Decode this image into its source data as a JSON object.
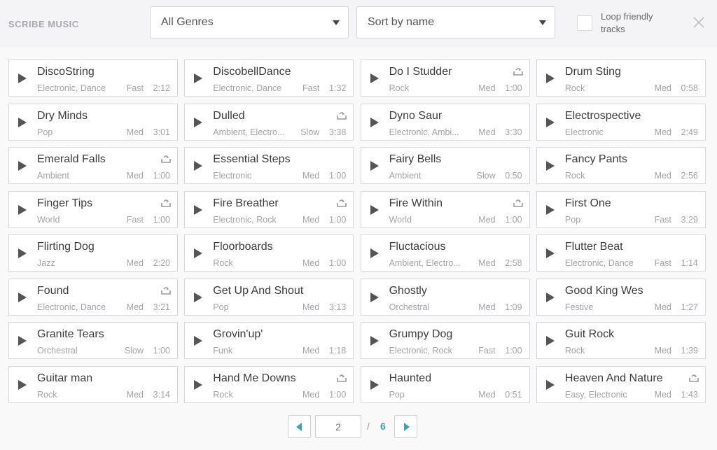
{
  "header": {
    "brand": "SCRIBE MUSIC",
    "genre_select": "All Genres",
    "sort_select": "Sort by name",
    "loop_label": "Loop friendly tracks"
  },
  "tracks": [
    {
      "title": "DiscoString",
      "genre": "Electronic, Dance",
      "speed": "Fast",
      "duration": "2:12",
      "loop": false
    },
    {
      "title": "DiscobellDance",
      "genre": "Electronic, Dance",
      "speed": "Fast",
      "duration": "1:32",
      "loop": false
    },
    {
      "title": "Do I Studder",
      "genre": "Rock",
      "speed": "Med",
      "duration": "1:00",
      "loop": true
    },
    {
      "title": "Drum Sting",
      "genre": "Rock",
      "speed": "Med",
      "duration": "0:58",
      "loop": false
    },
    {
      "title": "Dry Minds",
      "genre": "Pop",
      "speed": "Med",
      "duration": "3:01",
      "loop": false
    },
    {
      "title": "Dulled",
      "genre": "Ambient, Electro...",
      "speed": "Slow",
      "duration": "3:38",
      "loop": true
    },
    {
      "title": "Dyno Saur",
      "genre": "Electronic, Ambi...",
      "speed": "Med",
      "duration": "3:30",
      "loop": false
    },
    {
      "title": "Electrospective",
      "genre": "Electronic",
      "speed": "Med",
      "duration": "2:49",
      "loop": false
    },
    {
      "title": "Emerald Falls",
      "genre": "Ambient",
      "speed": "Med",
      "duration": "1:00",
      "loop": true
    },
    {
      "title": "Essential Steps",
      "genre": "Electronic",
      "speed": "Med",
      "duration": "1:00",
      "loop": false
    },
    {
      "title": "Fairy Bells",
      "genre": "Ambient",
      "speed": "Slow",
      "duration": "0:50",
      "loop": false
    },
    {
      "title": "Fancy Pants",
      "genre": "Rock",
      "speed": "Med",
      "duration": "2:56",
      "loop": false
    },
    {
      "title": "Finger Tips",
      "genre": "World",
      "speed": "Fast",
      "duration": "1:00",
      "loop": true
    },
    {
      "title": "Fire Breather",
      "genre": "Electronic, Rock",
      "speed": "Med",
      "duration": "1:00",
      "loop": true
    },
    {
      "title": "Fire Within",
      "genre": "World",
      "speed": "Med",
      "duration": "1:00",
      "loop": true
    },
    {
      "title": "First One",
      "genre": "Pop",
      "speed": "Fast",
      "duration": "3:29",
      "loop": false
    },
    {
      "title": "Flirting Dog",
      "genre": "Jazz",
      "speed": "Med",
      "duration": "2:20",
      "loop": false
    },
    {
      "title": "Floorboards",
      "genre": "Rock",
      "speed": "Med",
      "duration": "1:00",
      "loop": false
    },
    {
      "title": "Fluctacious",
      "genre": "Ambient, Electro...",
      "speed": "Med",
      "duration": "2:58",
      "loop": false
    },
    {
      "title": "Flutter Beat",
      "genre": "Electronic, Dance",
      "speed": "Fast",
      "duration": "1:14",
      "loop": false
    },
    {
      "title": "Found",
      "genre": "Electronic, Dance",
      "speed": "Med",
      "duration": "3:21",
      "loop": true
    },
    {
      "title": "Get Up And Shout",
      "genre": "Pop",
      "speed": "Med",
      "duration": "3:13",
      "loop": false
    },
    {
      "title": "Ghostly",
      "genre": "Orchestral",
      "speed": "Med",
      "duration": "1:09",
      "loop": false
    },
    {
      "title": "Good King Wes",
      "genre": "Festive",
      "speed": "Med",
      "duration": "1:27",
      "loop": false
    },
    {
      "title": "Granite Tears",
      "genre": "Orchestral",
      "speed": "Slow",
      "duration": "1:00",
      "loop": false
    },
    {
      "title": "Grovin'up'",
      "genre": "Funk",
      "speed": "Med",
      "duration": "1:18",
      "loop": false
    },
    {
      "title": "Grumpy Dog",
      "genre": "Electronic, Rock",
      "speed": "Fast",
      "duration": "1:00",
      "loop": false
    },
    {
      "title": "Guit Rock",
      "genre": "Rock",
      "speed": "Med",
      "duration": "1:39",
      "loop": false
    },
    {
      "title": "Guitar man",
      "genre": "Rock",
      "speed": "Med",
      "duration": "3:14",
      "loop": false
    },
    {
      "title": "Hand Me Downs",
      "genre": "Rock",
      "speed": "Med",
      "duration": "1:00",
      "loop": true
    },
    {
      "title": "Haunted",
      "genre": "Pop",
      "speed": "Med",
      "duration": "0:51",
      "loop": false
    },
    {
      "title": "Heaven And Nature",
      "genre": "Easy, Electronic",
      "speed": "Med",
      "duration": "1:43",
      "loop": true
    }
  ],
  "pagination": {
    "current": "2",
    "separator": "/",
    "total": "6"
  },
  "colors": {
    "accent": "#3aa0c4",
    "background": "#f4f4f6",
    "card_border": "#d8d8dc"
  }
}
